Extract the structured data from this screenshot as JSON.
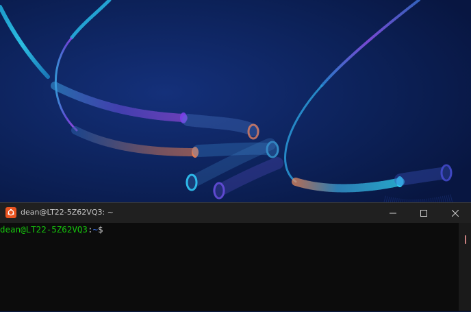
{
  "terminal": {
    "window_title": "dean@LT22-5Z62VQ3: ~",
    "app_icon": "ubuntu-icon",
    "prompt": {
      "user_host": "dean@LT22-5Z62VQ3",
      "colon": ":",
      "path": "~",
      "dollar": "$"
    },
    "controls": {
      "minimize_icon": "minimize-icon",
      "maximize_icon": "maximize-icon",
      "close_icon": "close-icon"
    }
  },
  "colors": {
    "wallpaper_bg": "#0a1b45",
    "terminal_bg": "#0c0c0c",
    "titlebar_bg": "#202020",
    "prompt_user": "#16c60c",
    "prompt_path": "#3b78ff",
    "ubuntu_orange": "#e95420"
  }
}
